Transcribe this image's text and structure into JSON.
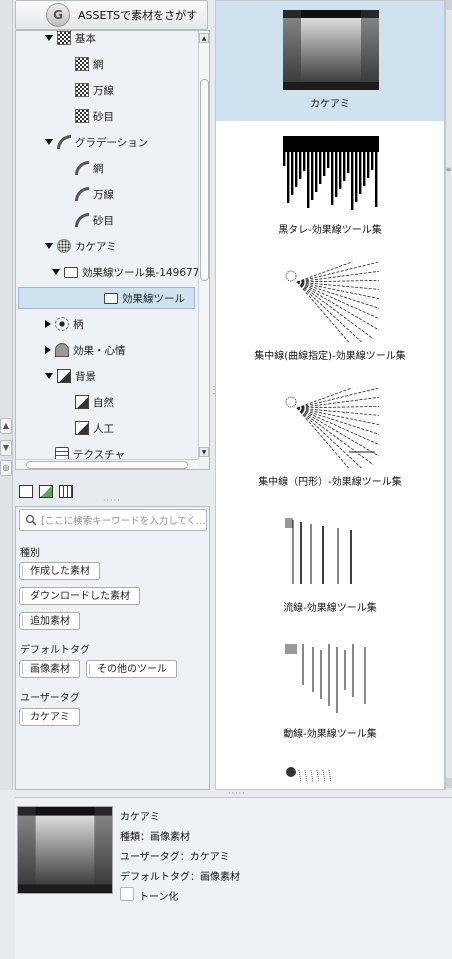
{
  "assets_button": {
    "label": "ASSETSで素材をさがす",
    "logo": "G"
  },
  "tree": {
    "items": [
      {
        "label": "基本",
        "expand": "expanded",
        "icon": "checker-icon",
        "level": 1
      },
      {
        "label": "網",
        "expand": "none",
        "icon": "checker-icon",
        "level": 2
      },
      {
        "label": "万線",
        "expand": "none",
        "icon": "checker-icon",
        "level": 2
      },
      {
        "label": "砂目",
        "expand": "none",
        "icon": "checker-icon",
        "level": 2
      },
      {
        "label": "グラデーション",
        "expand": "expanded",
        "icon": "gradient-icon",
        "level": 1
      },
      {
        "label": "網",
        "expand": "none",
        "icon": "gradient-icon",
        "level": 2
      },
      {
        "label": "万線",
        "expand": "none",
        "icon": "gradient-icon",
        "level": 2
      },
      {
        "label": "砂目",
        "expand": "none",
        "icon": "gradient-icon",
        "level": 2
      },
      {
        "label": "カケアミ",
        "expand": "expanded",
        "icon": "crosshatch-icon",
        "level": 1
      },
      {
        "label": "効果線ツール集-149677",
        "expand": "expanded",
        "icon": "folder-icon",
        "level": 2
      },
      {
        "label": "効果線ツール",
        "expand": "none",
        "icon": "folder-icon",
        "level": 3,
        "selected": true
      },
      {
        "label": "柄",
        "expand": "collapsed",
        "icon": "pattern-icon",
        "level": 1
      },
      {
        "label": "効果・心情",
        "expand": "collapsed",
        "icon": "heart-icon",
        "level": 1
      },
      {
        "label": "背景",
        "expand": "expanded",
        "icon": "landscape-icon",
        "level": 1
      },
      {
        "label": "自然",
        "expand": "none",
        "icon": "landscape-icon",
        "level": 2
      },
      {
        "label": "人工",
        "expand": "none",
        "icon": "landscape-icon",
        "level": 2
      },
      {
        "label": "テクスチャ",
        "expand": "none",
        "icon": "texture-icon",
        "level": 1
      }
    ]
  },
  "search": {
    "placeholder": "[ここに検索キーワードを入力してく…",
    "type_label": "種別",
    "type_tags": [
      "作成した素材",
      "ダウンロードした素材",
      "追加素材"
    ],
    "default_tag_label": "デフォルトタグ",
    "default_tags": [
      "画像素材",
      "その他のツール"
    ],
    "user_tag_label": "ユーザータグ",
    "user_tags": [
      "カケアミ"
    ]
  },
  "materials": {
    "items": [
      {
        "label": "カケアミ",
        "kind": "crosshatch",
        "selected": true
      },
      {
        "label": "黒タレ-効果線ツール集",
        "kind": "drip"
      },
      {
        "label": "集中線(曲線指定)-効果線ツール集",
        "kind": "focus"
      },
      {
        "label": "集中線（円形）-効果線ツール集",
        "kind": "focus-circle"
      },
      {
        "label": "流線-効果線ツール集",
        "kind": "speedlines"
      },
      {
        "label": "動線-効果線ツール集",
        "kind": "motionlines"
      },
      {
        "label": "",
        "kind": "partial"
      }
    ]
  },
  "detail": {
    "name": "カケアミ",
    "type_line": "種類：画像素材",
    "user_tag_line": "ユーザータグ：カケアミ",
    "default_tag_line": "デフォルトタグ：画像素材",
    "tone_label": "トーン化"
  }
}
